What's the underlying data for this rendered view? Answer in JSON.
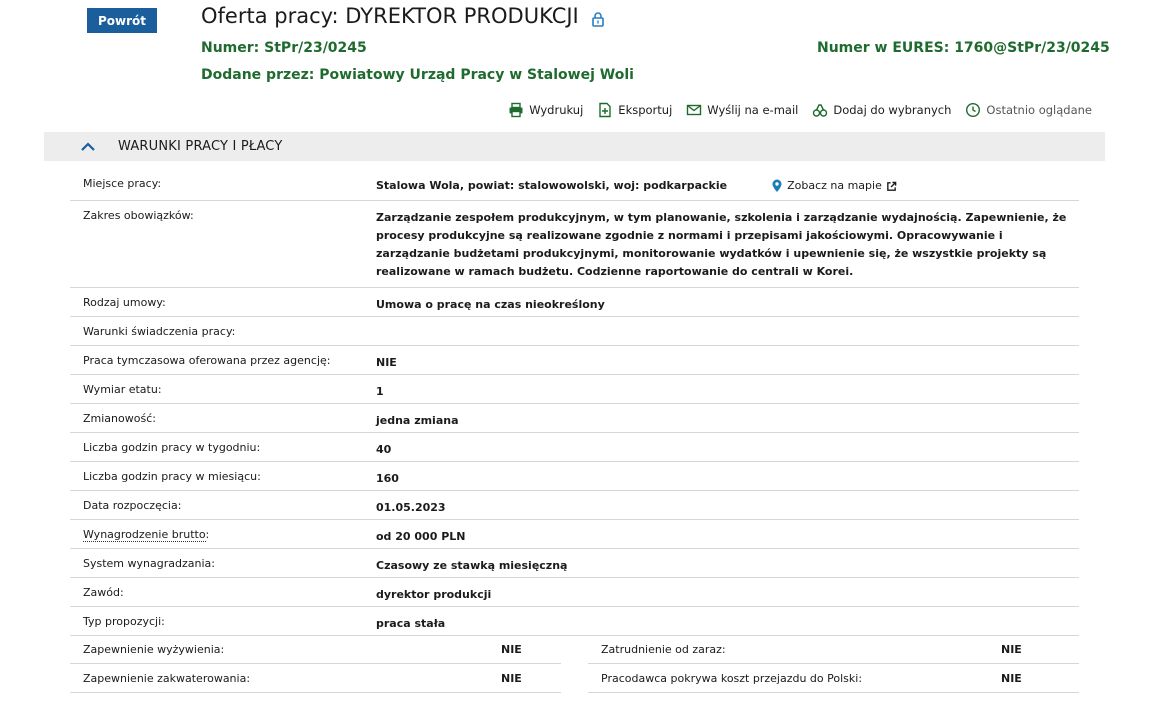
{
  "header": {
    "back_label": "Powrót",
    "title": "Oferta pracy: DYREKTOR PRODUKCJI",
    "number_label": "Numer:",
    "number_value": "StPr/23/0245",
    "eures_label": "Numer w EURES:",
    "eures_value": "1760@StPr/23/0245",
    "added_label": "Dodane przez:",
    "added_value": "Powiatowy Urząd Pracy w Stalowej Woli"
  },
  "toolbar": {
    "print": "Wydrukuj",
    "export": "Eksportuj",
    "email": "Wyślij na e-mail",
    "favorite": "Dodaj do wybranych",
    "recent": "Ostatnio oglądane"
  },
  "section": {
    "title": "WARUNKI PRACY I PŁACY"
  },
  "details": {
    "place_label": "Miejsce pracy:",
    "place_value": "Stalowa Wola, powiat: stalowowolski, woj: podkarpackie",
    "map_link": "Zobacz na mapie",
    "scope_label": "Zakres obowiązków:",
    "scope_value": "Zarządzanie zespołem produkcyjnym, w tym planowanie, szkolenia i zarządzanie wydajnością. Zapewnienie, że procesy produkcyjne są realizowane zgodnie z normami i przepisami jakościowymi. Opracowywanie i zarządzanie budżetami produkcyjnymi, monitorowanie wydatków i upewnienie się, że wszystkie projekty są realizowane w ramach budżetu. Codzienne raportowanie do centrali w Korei.",
    "contract_label": "Rodzaj umowy:",
    "contract_value": "Umowa o pracę na czas nieokreślony",
    "conditions_label": "Warunki świadczenia pracy:",
    "conditions_value": "",
    "temp_label": "Praca tymczasowa oferowana przez agencję:",
    "temp_value": "NIE",
    "fte_label": "Wymiar etatu:",
    "fte_value": "1",
    "shift_label": "Zmianowość:",
    "shift_value": "jedna zmiana",
    "hours_week_label": "Liczba godzin pracy w tygodniu:",
    "hours_week_value": "40",
    "hours_month_label": "Liczba godzin pracy w miesiącu:",
    "hours_month_value": "160",
    "start_label": "Data rozpoczęcia:",
    "start_value": "01.05.2023",
    "salary_label": "Wynagrodzenie brutto",
    "salary_colon": ":",
    "salary_value": "od 20 000 PLN",
    "pay_system_label": "System wynagradzania:",
    "pay_system_value": "Czasowy ze stawką miesięczną",
    "profession_label": "Zawód:",
    "profession_value": "dyrektor produkcji",
    "offer_type_label": "Typ propozycji:",
    "offer_type_value": "praca stała"
  },
  "extra_left": [
    {
      "label": "Zapewnienie wyżywienia:",
      "value": "NIE"
    },
    {
      "label": "Zapewnienie zakwaterowania:",
      "value": "NIE"
    }
  ],
  "extra_right": [
    {
      "label": "Zatrudnienie od zaraz:",
      "value": "NIE"
    },
    {
      "label": "Pracodawca pokrywa koszt przejazdu do Polski:",
      "value": "NIE"
    }
  ],
  "colors": {
    "brand_blue": "#1a5e9c",
    "green": "#1f6b2f",
    "section_bg": "#ededed"
  }
}
